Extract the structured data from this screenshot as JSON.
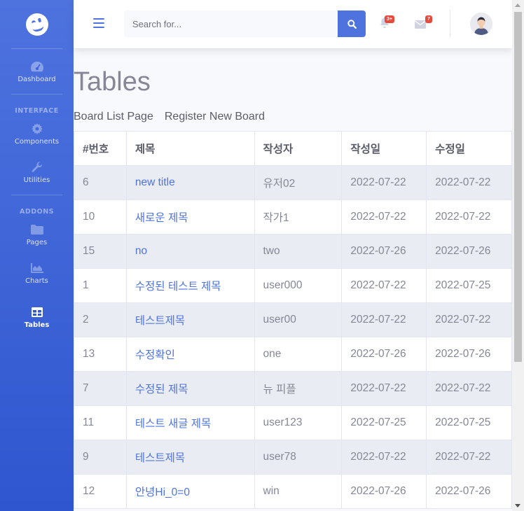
{
  "sidebar": {
    "brand_icon": "laugh-wink-icon",
    "items": [
      {
        "label": "Dashboard",
        "icon": "tachometer-icon"
      },
      {
        "label": "Components",
        "icon": "cog-icon"
      },
      {
        "label": "Utilities",
        "icon": "wrench-icon"
      },
      {
        "label": "Pages",
        "icon": "folder-icon"
      },
      {
        "label": "Charts",
        "icon": "chart-area-icon"
      },
      {
        "label": "Tables",
        "icon": "table-icon",
        "active": true
      }
    ],
    "headings": {
      "interface": "INTERFACE",
      "addons": "ADDONS"
    }
  },
  "topbar": {
    "search_placeholder": "Search for...",
    "alerts_badge": "3+",
    "messages_badge": "7"
  },
  "page": {
    "title": "Tables",
    "links": [
      "Board List Page",
      "Register New Board"
    ]
  },
  "table": {
    "headers": [
      "#번호",
      "제목",
      "작성자",
      "작성일",
      "수정일"
    ],
    "rows": [
      [
        "6",
        "new title",
        "유저02",
        "2022-07-22",
        "2022-07-22"
      ],
      [
        "10",
        "새로운 제목",
        "작가1",
        "2022-07-22",
        "2022-07-22"
      ],
      [
        "15",
        "no",
        "two",
        "2022-07-26",
        "2022-07-26"
      ],
      [
        "1",
        "수정된 테스트 제목",
        "user000",
        "2022-07-22",
        "2022-07-25"
      ],
      [
        "2",
        "테스트제목",
        "user00",
        "2022-07-22",
        "2022-07-22"
      ],
      [
        "13",
        "수정확인",
        "one",
        "2022-07-26",
        "2022-07-26"
      ],
      [
        "7",
        "수정된 제목",
        "뉴 피플",
        "2022-07-22",
        "2022-07-22"
      ],
      [
        "11",
        "테스트 새글 제목",
        "user123",
        "2022-07-25",
        "2022-07-25"
      ],
      [
        "9",
        "테스트제목",
        "user78",
        "2022-07-22",
        "2022-07-22"
      ],
      [
        "12",
        "안녕Hi_0=0",
        "win",
        "2022-07-26",
        "2022-07-26"
      ]
    ]
  },
  "colors": {
    "primary": "#4e73df",
    "danger": "#e74a3b",
    "text": "#858796",
    "stripe": "#eaecf4"
  }
}
